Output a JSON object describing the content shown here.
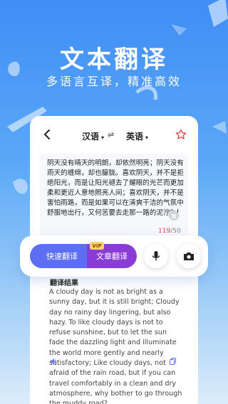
{
  "hero": {
    "title": "文本翻译",
    "subtitle": "多语言互译，精准高效"
  },
  "topbar": {
    "source_lang": "汉语",
    "target_lang": "英语",
    "swap_symbol": "⇌",
    "caret": "▾"
  },
  "input": {
    "text": "阴天没有晴天的明朗，却依然明亮；阴天没有雨天的缠绵，却也朦胧。喜欢阴天，并不是拒绝阳光，而是让阳光褪去了耀眼的光芒而更加柔和更近人意地照亮人间；喜欢阴天，并不是害怕雨路，而是如果可以在清爽干洁的气氛中舒服地出行，又何苦要去走那一路的泥泞？"
  },
  "counter": {
    "current": "119",
    "max": "/50"
  },
  "actions": {
    "fast_translate": "快速翻译",
    "article_translate": "文章翻译",
    "vip_badge": "VIP"
  },
  "result": {
    "title": "翻译结果",
    "text": "A cloudy day is not as bright as a sunny day, but it is still bright; Cloudy day no rainy day lingering, but also hazy. To like cloudy days is not to refuse sunshine, but to let the sun fade the dazzling light and illuminate the world more gently and nearly satisfactory; Like cloudy days, not afraid of the rain road, but if you can travel comfortably in a clean and dry atmosphere, why bother to go through the muddy road?"
  },
  "icons": {
    "back": "chevron-left-icon",
    "swap": "swap-icon",
    "favorite": "star-outline-icon",
    "clear": "clear-circle-icon",
    "mic": "microphone-icon",
    "camera": "camera-icon",
    "speaker": "speaker-icon",
    "copy": "copy-icon"
  },
  "colors": {
    "accent_blue": "#5c6ff2",
    "accent_purple": "#8a3cd6",
    "counter_red": "#e5484d",
    "star_red": "#e5484d"
  }
}
